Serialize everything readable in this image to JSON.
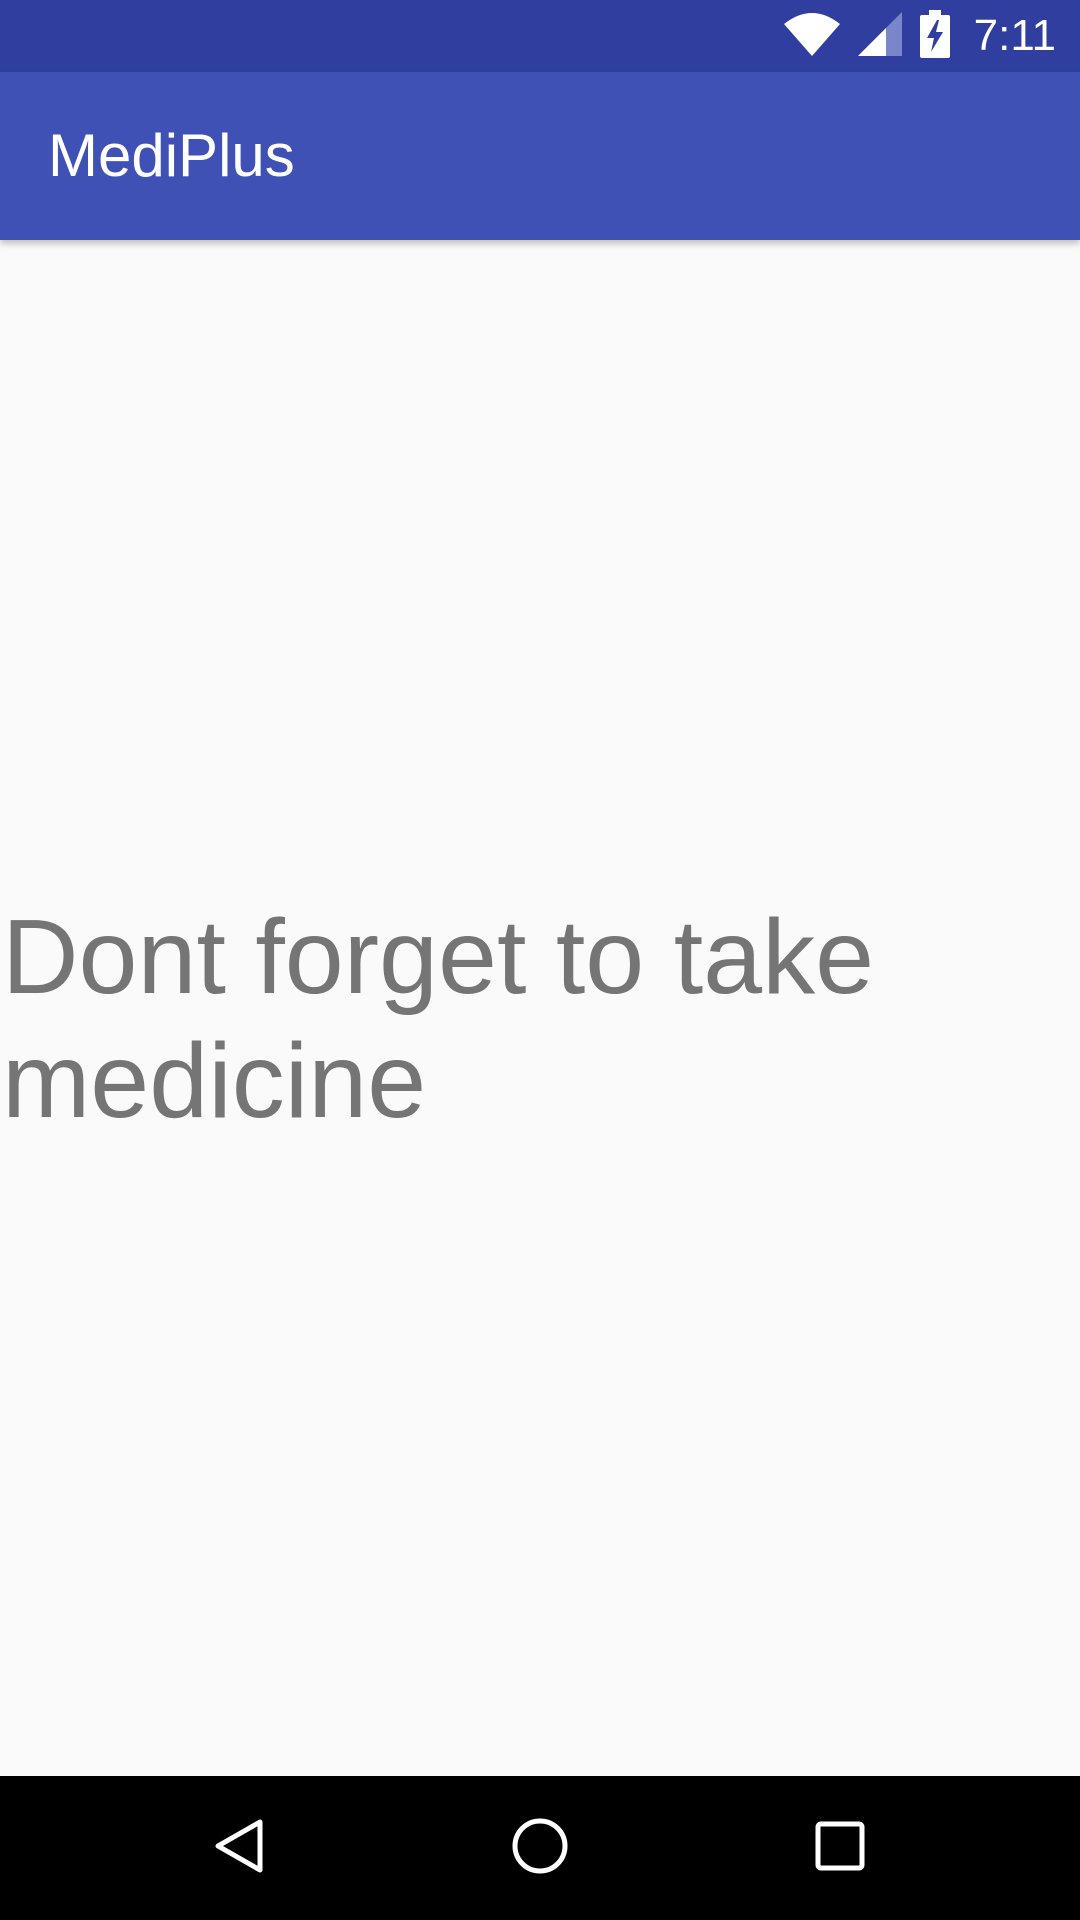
{
  "status_bar": {
    "time": "7:11",
    "icons": [
      "wifi-icon",
      "cellular-signal-icon",
      "battery-charging-icon"
    ]
  },
  "app_bar": {
    "title": "MediPlus"
  },
  "main": {
    "message": "Dont forget to take medicine"
  },
  "nav_bar": {
    "buttons": [
      "back-icon",
      "home-icon",
      "recents-icon"
    ]
  },
  "colors": {
    "status_bar": "#303f9f",
    "app_bar": "#3f51b5",
    "background": "#fafafa",
    "message_text": "#757575",
    "nav_bar": "#000000"
  }
}
